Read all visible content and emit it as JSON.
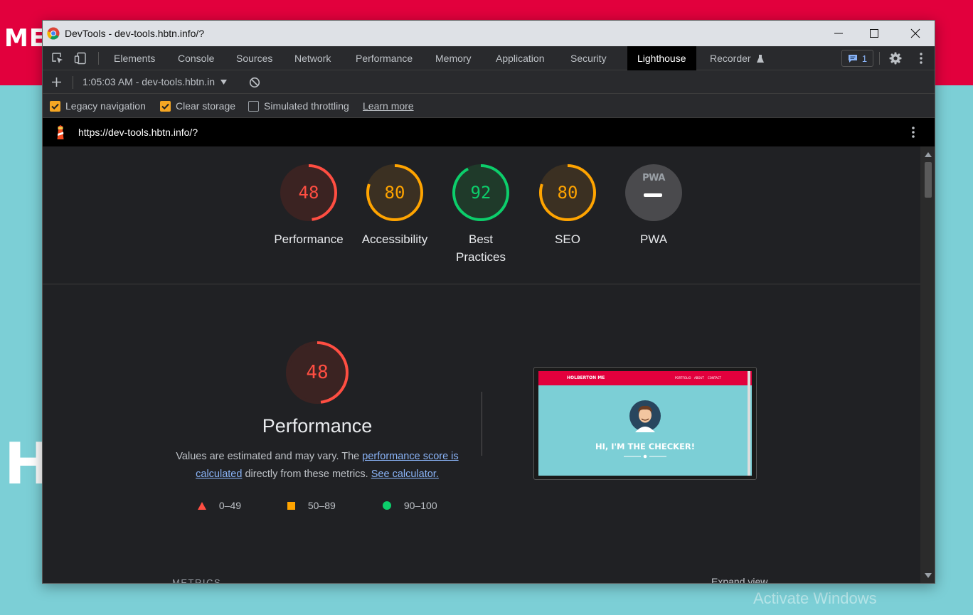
{
  "background": {
    "logo": "ME",
    "hero_letter": "H",
    "watermark": "Activate Windows"
  },
  "window": {
    "title": "DevTools - dev-tools.hbtn.info/?"
  },
  "tabs": [
    {
      "label": "Elements"
    },
    {
      "label": "Console"
    },
    {
      "label": "Sources"
    },
    {
      "label": "Network"
    },
    {
      "label": "Performance"
    },
    {
      "label": "Memory"
    },
    {
      "label": "Application"
    },
    {
      "label": "Security"
    },
    {
      "label": "Lighthouse",
      "active": true
    },
    {
      "label": "Recorder"
    }
  ],
  "issues_badge": "1",
  "toolbar": {
    "report_select": "1:05:03 AM - dev-tools.hbtn.in"
  },
  "options": {
    "legacy_navigation": {
      "label": "Legacy navigation",
      "checked": true
    },
    "clear_storage": {
      "label": "Clear storage",
      "checked": true
    },
    "simulated_throttling": {
      "label": "Simulated throttling",
      "checked": false
    },
    "learn_more": "Learn more"
  },
  "url": "https://dev-tools.hbtn.info/?",
  "scores": [
    {
      "label": "Performance",
      "value": "48",
      "score": 0.48,
      "status": "fail",
      "color": "#ff4e42"
    },
    {
      "label": "Accessibility",
      "value": "80",
      "score": 0.8,
      "status": "average",
      "color": "#ffa400"
    },
    {
      "label": "Best Practices",
      "value": "92",
      "score": 0.92,
      "status": "pass",
      "color": "#0cce6b"
    },
    {
      "label": "SEO",
      "value": "80",
      "score": 0.8,
      "status": "average",
      "color": "#ffa400"
    },
    {
      "label": "PWA",
      "value": "PWA",
      "status": "na",
      "color": "#5f6368"
    }
  ],
  "performance": {
    "score": "48",
    "score_fraction": 0.48,
    "title": "Performance",
    "desc_prefix": "Values are estimated and may vary. The ",
    "desc_link1": "performance score is calculated",
    "desc_middle": " directly from these metrics. ",
    "desc_link2": "See calculator."
  },
  "legend": [
    {
      "range": "0–49",
      "shape": "triangle",
      "color": "#ff4e42"
    },
    {
      "range": "50–89",
      "shape": "square",
      "color": "#ffa400"
    },
    {
      "range": "90–100",
      "shape": "circle",
      "color": "#0cce6b"
    }
  ],
  "screenshot": {
    "logo": "HOLBERTON ME",
    "nav": [
      "PORTFOLIO",
      "ABOUT",
      "CONTACT"
    ],
    "hero": "HI, I'M THE CHECKER!"
  },
  "metrics_label": "METRICS",
  "expand_view": "Expand view"
}
